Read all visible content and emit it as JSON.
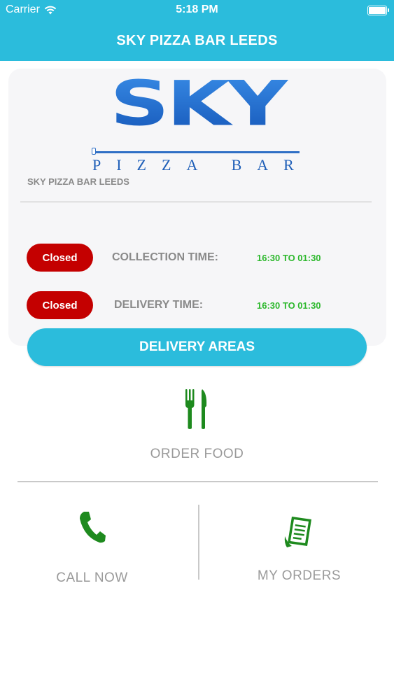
{
  "status_bar": {
    "carrier": "Carrier",
    "time": "5:18 PM",
    "wifi_icon": "wifi-icon",
    "battery_icon": "battery-icon"
  },
  "nav": {
    "title": "SKY PIZZA BAR LEEDS"
  },
  "shop": {
    "logo_text": "SKY",
    "logo_subtext": "PIZZA BAR",
    "name": "SKY PIZZA BAR LEEDS"
  },
  "hours": [
    {
      "status": "Closed",
      "label": "COLLECTION TIME:",
      "value": "16:30 TO 01:30"
    },
    {
      "status": "Closed",
      "label": "DELIVERY TIME:",
      "value": "16:30 TO 01:30"
    }
  ],
  "delivery_areas": {
    "label": "DELIVERY AREAS"
  },
  "menu": {
    "order_food": {
      "label": "ORDER FOOD",
      "icon": "fork-knife-icon"
    },
    "call_now": {
      "label": "CALL NOW",
      "icon": "phone-icon"
    },
    "my_orders": {
      "label": "MY ORDERS",
      "icon": "receipt-icon"
    }
  },
  "colors": {
    "brand": "#2bbcdc",
    "closed": "#c40000",
    "time_value": "#2db82d",
    "icon_green": "#1e8a1e",
    "logo_blue": "#1f6fd0"
  }
}
